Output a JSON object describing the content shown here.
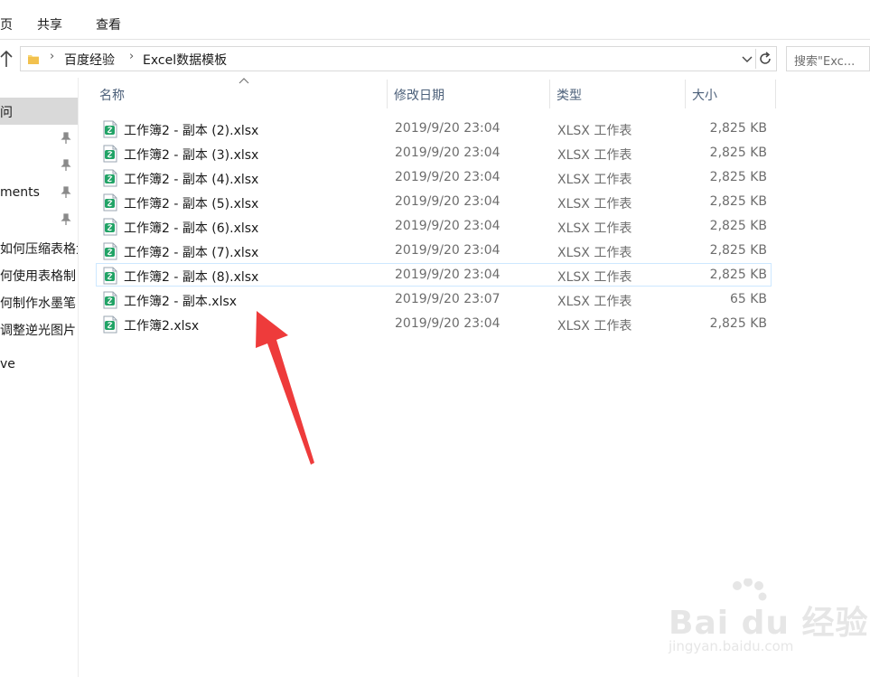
{
  "ribbon": {
    "tabs": [
      {
        "label": "页"
      },
      {
        "label": "共享"
      },
      {
        "label": "查看"
      }
    ]
  },
  "address": {
    "crumbs": [
      "百度经验",
      "Excel数据模板"
    ],
    "search_placeholder": "搜索\"Exc..."
  },
  "nav": {
    "items": [
      {
        "label": "问",
        "pinned": false,
        "selected": true
      },
      {
        "label": "",
        "pinned": true
      },
      {
        "label": "",
        "pinned": true
      },
      {
        "label": "ments",
        "pinned": true
      },
      {
        "label": "",
        "pinned": true
      },
      {
        "label": "如何压缩表格大",
        "pinned": false
      },
      {
        "label": "何使用表格制",
        "pinned": false
      },
      {
        "label": "何制作水墨笔",
        "pinned": false
      },
      {
        "label": "调整逆光图片",
        "pinned": false
      },
      {
        "label": "ve",
        "pinned": false
      }
    ]
  },
  "columns": {
    "name": "名称",
    "date": "修改日期",
    "type": "类型",
    "size": "大小"
  },
  "files": [
    {
      "name": "工作簿2 - 副本 (2).xlsx",
      "date": "2019/9/20 23:04",
      "type": "XLSX 工作表",
      "size": "2,825 KB"
    },
    {
      "name": "工作簿2 - 副本 (3).xlsx",
      "date": "2019/9/20 23:04",
      "type": "XLSX 工作表",
      "size": "2,825 KB"
    },
    {
      "name": "工作簿2 - 副本 (4).xlsx",
      "date": "2019/9/20 23:04",
      "type": "XLSX 工作表",
      "size": "2,825 KB"
    },
    {
      "name": "工作簿2 - 副本 (5).xlsx",
      "date": "2019/9/20 23:04",
      "type": "XLSX 工作表",
      "size": "2,825 KB"
    },
    {
      "name": "工作簿2 - 副本 (6).xlsx",
      "date": "2019/9/20 23:04",
      "type": "XLSX 工作表",
      "size": "2,825 KB"
    },
    {
      "name": "工作簿2 - 副本 (7).xlsx",
      "date": "2019/9/20 23:04",
      "type": "XLSX 工作表",
      "size": "2,825 KB"
    },
    {
      "name": "工作簿2 - 副本 (8).xlsx",
      "date": "2019/9/20 23:04",
      "type": "XLSX 工作表",
      "size": "2,825 KB",
      "focused": true
    },
    {
      "name": "工作簿2 - 副本.xlsx",
      "date": "2019/9/20 23:07",
      "type": "XLSX 工作表",
      "size": "65 KB"
    },
    {
      "name": "工作簿2.xlsx",
      "date": "2019/9/20 23:04",
      "type": "XLSX 工作表",
      "size": "2,825 KB"
    }
  ],
  "watermark": {
    "logo": "Bai du 经验",
    "url": "jingyan.baidu.com"
  },
  "colors": {
    "excel_icon": "#21a366",
    "annotation": "#ee3b3b",
    "header_text": "#4c607a"
  }
}
